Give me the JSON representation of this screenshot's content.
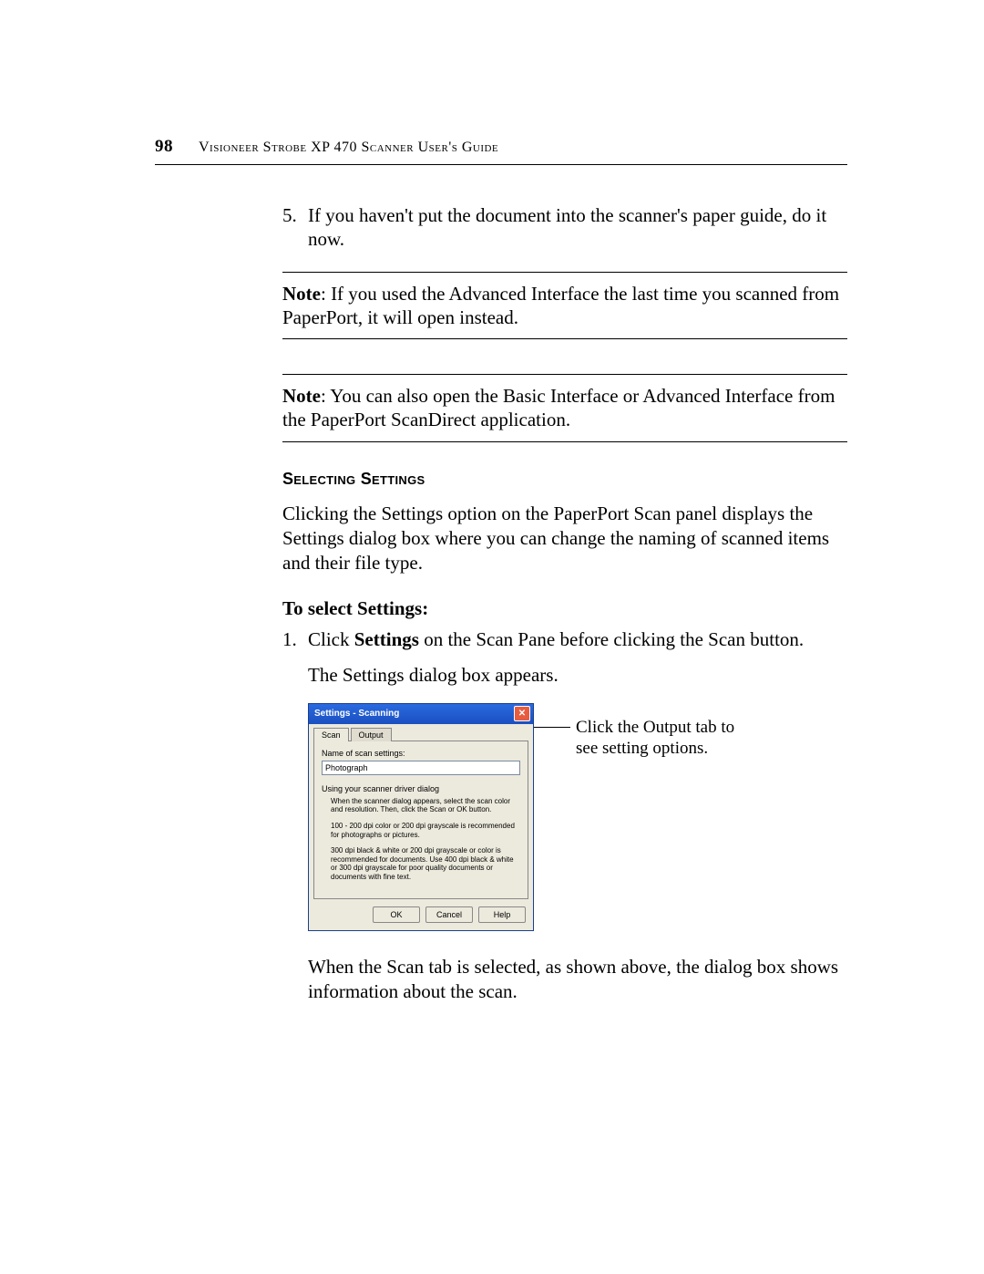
{
  "header": {
    "page_number": "98",
    "title": "Visioneer Strobe XP 470 Scanner User's Guide"
  },
  "step5": {
    "num": "5.",
    "text": "If you haven't put the document into the scanner's paper guide, do it now."
  },
  "note1": {
    "label": "Note",
    "text": ":  If you used the Advanced Interface the last time you scanned from PaperPort, it will open instead."
  },
  "note2": {
    "label": "Note",
    "text": ":  You can also open the Basic Interface or Advanced Interface from the PaperPort ScanDirect application."
  },
  "section_heading": "Selecting Settings",
  "section_intro": "Clicking the Settings option on the PaperPort Scan panel displays the Settings dialog box where you can change the naming of scanned items and their file type.",
  "sub_heading": "To select Settings:",
  "step1": {
    "num": "1.",
    "text_before": "Click ",
    "bold": "Settings",
    "text_after": " on the Scan Pane before clicking the Scan button.",
    "follow": "The Settings dialog box appears."
  },
  "dialog": {
    "title": "Settings - Scanning",
    "close": "✕",
    "tabs": {
      "scan": "Scan",
      "output": "Output"
    },
    "name_label": "Name of scan settings:",
    "name_value": "Photograph",
    "using_label": "Using your scanner driver dialog",
    "desc1": "When the scanner dialog appears, select the scan color and resolution. Then, click the Scan or OK button.",
    "desc2": "100 - 200 dpi color or 200 dpi grayscale is recommended for photographs or pictures.",
    "desc3": "300 dpi black & white or 200 dpi grayscale or color is recommended for documents. Use 400 dpi black & white or 300 dpi grayscale for poor quality documents or documents with fine text.",
    "buttons": {
      "ok": "OK",
      "cancel": "Cancel",
      "help": "Help"
    }
  },
  "callout": "Click the Output tab to see setting options.",
  "after_figure": "When the Scan tab is selected, as shown above, the dialog box shows information about the scan."
}
